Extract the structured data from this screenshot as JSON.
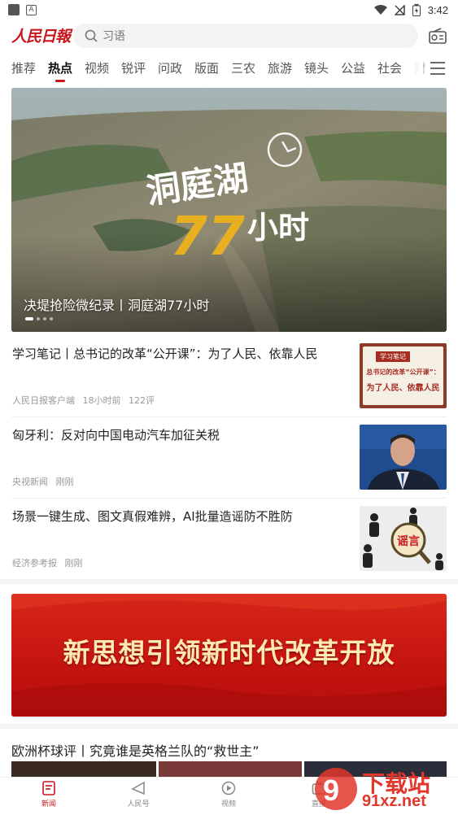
{
  "status_bar": {
    "time": "3:42"
  },
  "header": {
    "logo_text": "人民日報",
    "search_placeholder": "习语"
  },
  "tabs": [
    {
      "label": "推荐"
    },
    {
      "label": "热点"
    },
    {
      "label": "视频"
    },
    {
      "label": "锐评"
    },
    {
      "label": "问政"
    },
    {
      "label": "版面"
    },
    {
      "label": "三农"
    },
    {
      "label": "旅游"
    },
    {
      "label": "镜头"
    },
    {
      "label": "公益"
    },
    {
      "label": "社会"
    },
    {
      "label": "财"
    }
  ],
  "active_tab": "热点",
  "hero": {
    "caption": "决堤抢险微纪录丨洞庭湖77小时",
    "overlay_title_line1": "洞庭湖",
    "overlay_title_number": "77",
    "overlay_title_suffix": "小时"
  },
  "news": [
    {
      "title": "学习笔记丨总书记的改革“公开课”：为了人民、依靠人民",
      "source": "人民日报客户端",
      "time": "18小时前",
      "comments": "122评",
      "thumb_label": "学习笔记",
      "thumb_line1": "总书记的改革“公开课”：",
      "thumb_line2": "为了人民、依靠人民"
    },
    {
      "title": "匈牙利：反对向中国电动汽车加征关税",
      "source": "央视新闻",
      "time": "刚刚"
    },
    {
      "title": "场景一键生成、图文真假难辨，AI批量造谣防不胜防",
      "source": "经济参考报",
      "time": "刚刚",
      "thumb_label": "谣言"
    }
  ],
  "banner": {
    "text": "新思想引领新时代改革开放"
  },
  "section": {
    "title": "欧洲杯球评丨究竟谁是英格兰队的“救世主”"
  },
  "bottom_nav": [
    {
      "label": "新闻",
      "icon": "news-icon",
      "active": true
    },
    {
      "label": "人民号",
      "icon": "send-icon",
      "active": false
    },
    {
      "label": "视频",
      "icon": "play-icon",
      "active": false
    },
    {
      "label": "直播",
      "icon": "live-icon",
      "active": false
    }
  ],
  "watermark": {
    "text": "下载站",
    "url": "91xz.net"
  },
  "colors": {
    "brand_red": "#c8161d",
    "banner_text": "#fde9b4"
  }
}
